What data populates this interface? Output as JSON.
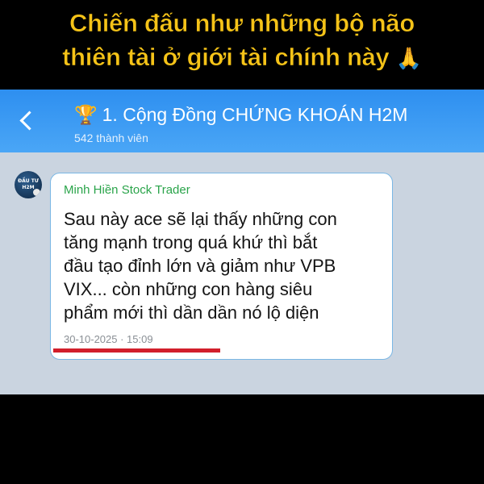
{
  "caption": {
    "line1": "Chiến đấu như những bộ não",
    "line2": "thiên tài ở giới tài chính này",
    "emoji": "🙏"
  },
  "header": {
    "trophy": "🏆",
    "title": "1. Cộng Đồng CHỨNG KHOÁN H2M",
    "members": "542 thành viên"
  },
  "avatar": {
    "line1": "ĐẦU TƯ",
    "line2": "H2M"
  },
  "message": {
    "sender": "Minh Hiền Stock Trader",
    "lines": [
      "Sau này ace sẽ lại thấy những con",
      "tăng mạnh trong quá khứ thì bắt",
      "đầu tạo đỉnh lớn và giảm như VPB",
      "VIX... còn những con hàng siêu",
      "phẩm mới thì dần dần nó lộ diện"
    ],
    "timestamp": "30-10-2025 · 15:09"
  },
  "colors": {
    "caption": "#f5c318",
    "header": "#3a9bf3",
    "sender": "#2aa44a",
    "underline": "#d21f2b",
    "chat_bg": "#cad4e0"
  }
}
